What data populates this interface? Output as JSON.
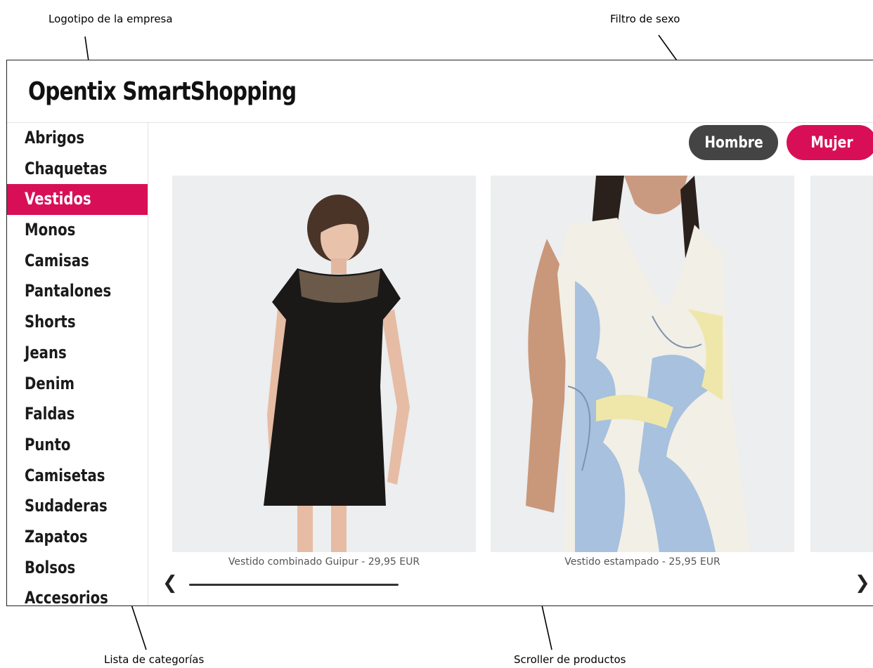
{
  "annotations": {
    "logo": "Logotipo de la empresa",
    "gender_filter": "Filtro de sexo",
    "category_list": "Lista de categorías",
    "product_scroller": "Scroller de productos"
  },
  "header": {
    "logo_text": "Opentix SmartShopping"
  },
  "gender": {
    "male_label": "Hombre",
    "female_label": "Mujer",
    "selected": "Mujer"
  },
  "categories": {
    "selected": "Vestidos",
    "items": [
      "Abrigos",
      "Chaquetas",
      "Vestidos",
      "Monos",
      "Camisas",
      "Pantalones",
      "Shorts",
      "Jeans",
      "Denim",
      "Faldas",
      "Punto",
      "Camisetas",
      "Sudaderas",
      "Zapatos",
      "Bolsos",
      "Accesorios"
    ]
  },
  "products": [
    {
      "caption": "Vestido combinado Guipur - 29,95 EUR"
    },
    {
      "caption": "Vestido estampado - 25,95 EUR"
    }
  ],
  "colors": {
    "accent": "#d80f56",
    "male_button": "#444444"
  },
  "icons": {
    "scroll_left": "chevron-left-icon",
    "scroll_right": "chevron-right-icon"
  }
}
